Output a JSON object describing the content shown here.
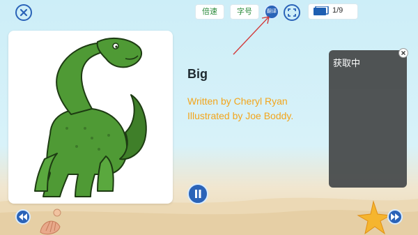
{
  "toolbar": {
    "speed_label": "倍速",
    "fontsize_label": "字号",
    "translate_label": "翻译",
    "page_counter": "1/9"
  },
  "book": {
    "title": "Big",
    "written_by": "Written by Cheryl Ryan",
    "illustrated_by": "Illustrated by Joe Boddy."
  },
  "overlay": {
    "status_text": "获取中"
  },
  "icons": {
    "close": "close-icon",
    "translate": "translate-icon",
    "fullscreen": "fullscreen-icon",
    "page": "page-icon",
    "pause": "pause-icon",
    "prev": "rewind-icon",
    "next": "fast-forward-icon"
  },
  "colors": {
    "accent_blue": "#2a63b8",
    "credit_orange": "#f3a51b",
    "pill_text_green": "#2a8a3a",
    "overlay_bg": "#4a4d4e"
  }
}
